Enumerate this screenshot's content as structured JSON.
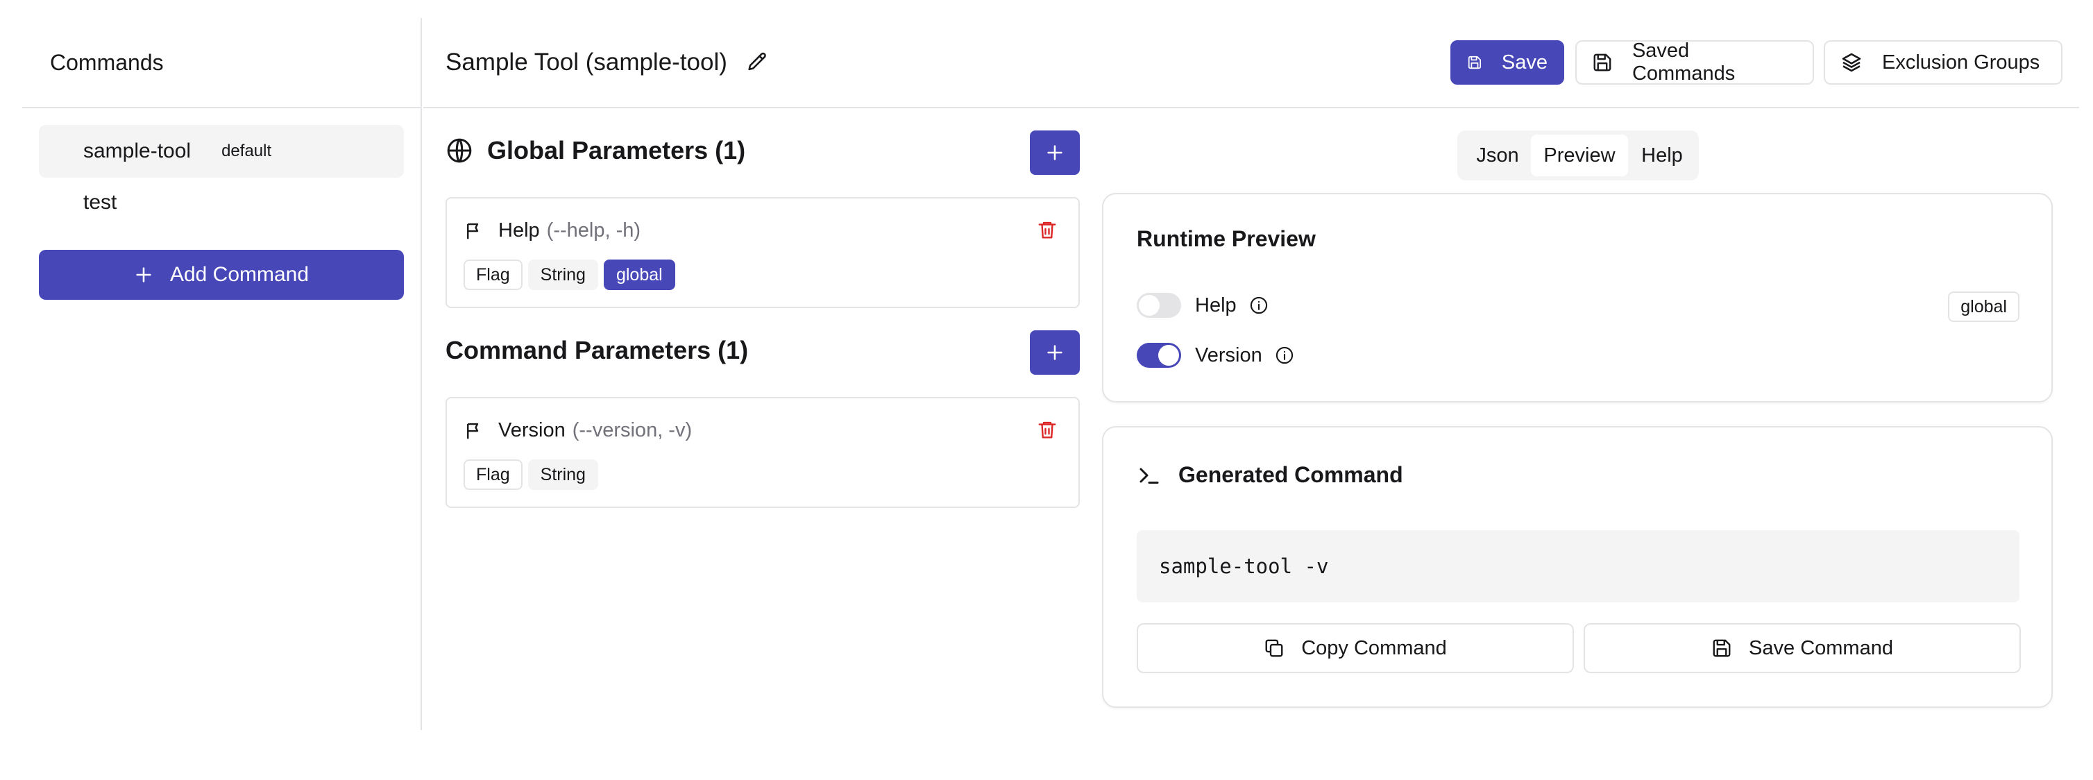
{
  "sidebar": {
    "title": "Commands",
    "commands": [
      {
        "name": "sample-tool",
        "badge": "default"
      },
      {
        "name": "test",
        "badge": ""
      }
    ],
    "add_label": "Add Command"
  },
  "header": {
    "title": "Sample Tool (sample-tool)",
    "save_label": "Save",
    "saved_commands_label": "Saved Commands",
    "exclusion_groups_label": "Exclusion Groups"
  },
  "global_params": {
    "title": "Global Parameters (1)",
    "items": [
      {
        "name": "Help",
        "alias": "(--help, -h)",
        "tags": [
          "Flag",
          "String",
          "global"
        ]
      }
    ]
  },
  "command_params": {
    "title": "Command Parameters (1)",
    "items": [
      {
        "name": "Version",
        "alias": "(--version, -v)",
        "tags": [
          "Flag",
          "String"
        ]
      }
    ]
  },
  "tabs": [
    {
      "label": "Json"
    },
    {
      "label": "Preview",
      "active": true
    },
    {
      "label": "Help"
    }
  ],
  "runtime_preview": {
    "title": "Runtime Preview",
    "toggles": [
      {
        "label": "Help",
        "on": false,
        "badge": "global"
      },
      {
        "label": "Version",
        "on": true
      }
    ]
  },
  "generated": {
    "title": "Generated Command",
    "command": "sample-tool -v",
    "copy_label": "Copy Command",
    "save_label": "Save Command"
  },
  "colors": {
    "primary": "#4747b8",
    "border": "#e4e4e7",
    "muted_bg": "#f4f4f5",
    "danger": "#dc2626"
  },
  "icons": {
    "edit": "pencil-icon",
    "save": "floppy-disk-icon",
    "layers": "layers-icon",
    "globe": "globe-icon",
    "flag": "flag-icon",
    "trash": "trash-icon",
    "plus": "plus-icon",
    "info": "info-icon",
    "terminal": "terminal-icon",
    "copy": "copy-icon"
  }
}
